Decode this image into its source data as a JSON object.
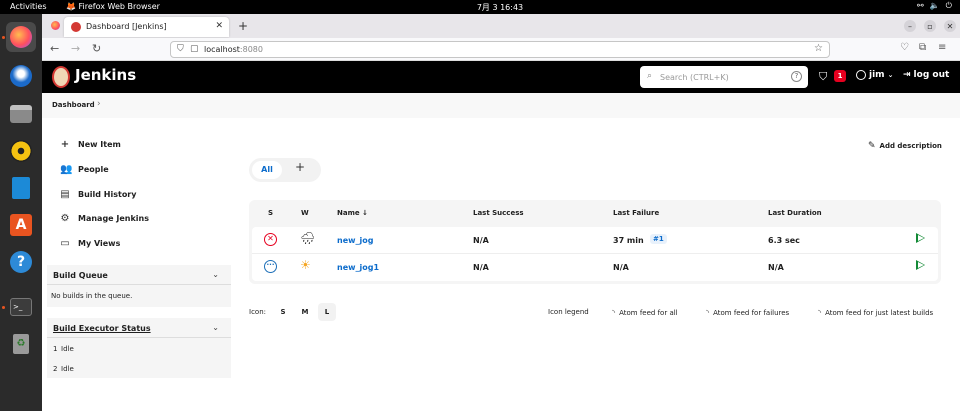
{
  "system_bar": {
    "activities": "Activities",
    "app_name": "Firefox Web Browser",
    "clock": "7月 3  16:43"
  },
  "browser": {
    "tab_title": "Dashboard [Jenkins]",
    "url_host": "localhost",
    "url_port": ":8080"
  },
  "jenkins_header": {
    "title": "Jenkins",
    "search_placeholder": "Search (CTRL+K)",
    "security_badge": "1",
    "user": "jim",
    "logout": "log out"
  },
  "breadcrumb": {
    "items": [
      "Dashboard"
    ]
  },
  "sidebar": {
    "items": [
      {
        "label": "New Item",
        "icon": "plus-icon"
      },
      {
        "label": "People",
        "icon": "people-icon"
      },
      {
        "label": "Build History",
        "icon": "history-icon"
      },
      {
        "label": "Manage Jenkins",
        "icon": "gear-icon"
      },
      {
        "label": "My Views",
        "icon": "window-icon"
      }
    ],
    "build_queue": {
      "title": "Build Queue",
      "empty_text": "No builds in the queue."
    },
    "executors": {
      "title": "Build Executor Status",
      "entries": [
        {
          "num": "1",
          "state": "Idle"
        },
        {
          "num": "2",
          "state": "Idle"
        }
      ]
    }
  },
  "main": {
    "add_description": "Add description",
    "view_tabs": [
      "All"
    ],
    "table": {
      "headers": [
        "S",
        "W",
        "Name ↓",
        "Last Success",
        "Last Failure",
        "Last Duration"
      ],
      "rows": [
        {
          "status": "failed",
          "weather": "cloudy-rain-icon",
          "name": "new_jog",
          "last_success": "N/A",
          "last_failure": "37 min",
          "last_failure_build": "#1",
          "last_duration": "6.3 sec"
        },
        {
          "status": "not-built",
          "weather": "sunny-icon",
          "name": "new_jog1",
          "last_success": "N/A",
          "last_failure": "N/A",
          "last_duration": "N/A"
        }
      ]
    },
    "icon_label": "Icon:",
    "icon_sizes": [
      "S",
      "M",
      "L"
    ],
    "icon_size_selected": "L",
    "footer_links": {
      "legend": "Icon legend",
      "feed_all": "Atom feed for all",
      "feed_failures": "Atom feed for failures",
      "feed_latest": "Atom feed for just latest builds"
    }
  },
  "colors": {
    "jenkins_header": "#000000",
    "link_blue": "#0b6bcb",
    "failure_red": "#e6001f",
    "run_green": "#138a36",
    "dock": "#2b2b2b"
  }
}
